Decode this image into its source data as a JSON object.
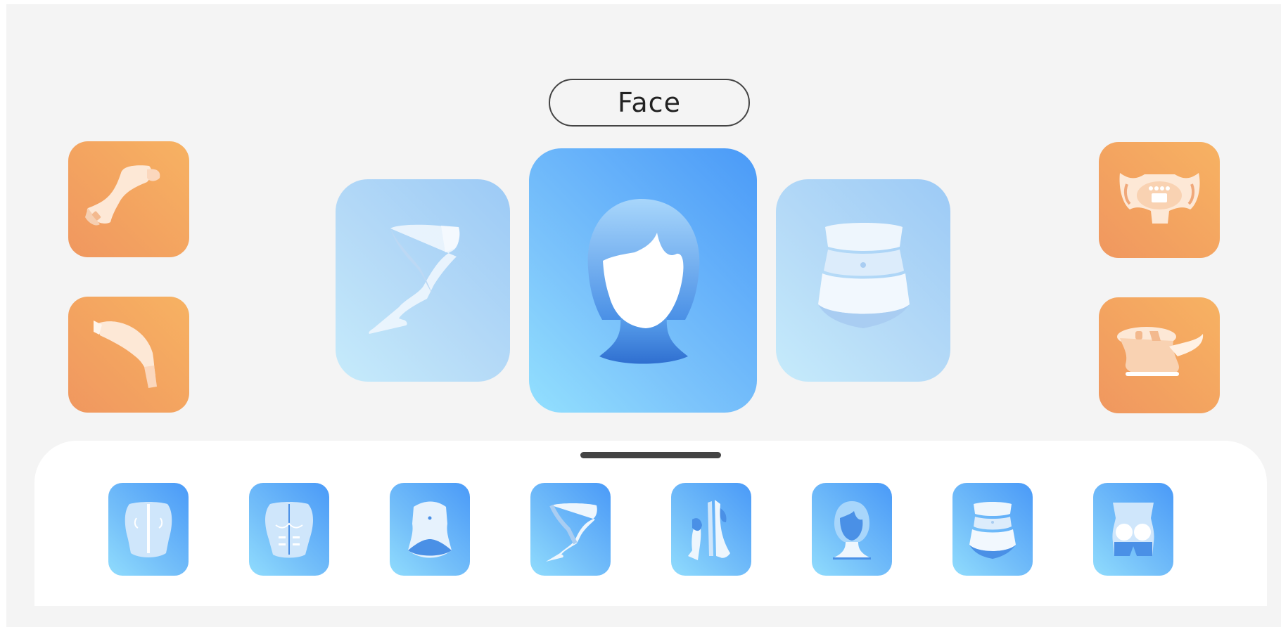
{
  "header": {
    "current_area": "Face"
  },
  "devices": {
    "left": [
      {
        "icon": "handpiece-device-icon"
      },
      {
        "icon": "curved-handpiece-icon"
      }
    ],
    "right": [
      {
        "icon": "control-unit-icon"
      },
      {
        "icon": "sculpting-device-icon"
      }
    ]
  },
  "carousel": {
    "prev": {
      "icon": "legs-icon"
    },
    "current": {
      "icon": "face-icon"
    },
    "next": {
      "icon": "waist-icon"
    }
  },
  "tray": {
    "items": [
      {
        "icon": "back-icon"
      },
      {
        "icon": "chest-abs-icon"
      },
      {
        "icon": "abdomen-icon"
      },
      {
        "icon": "legs-icon"
      },
      {
        "icon": "arms-icon"
      },
      {
        "icon": "face-neck-icon"
      },
      {
        "icon": "waist-icon"
      },
      {
        "icon": "buttocks-icon"
      }
    ]
  },
  "colors": {
    "accent_orange": "#f0975f",
    "accent_blue": "#4a9af8",
    "light_blue": "#93e0fe"
  }
}
